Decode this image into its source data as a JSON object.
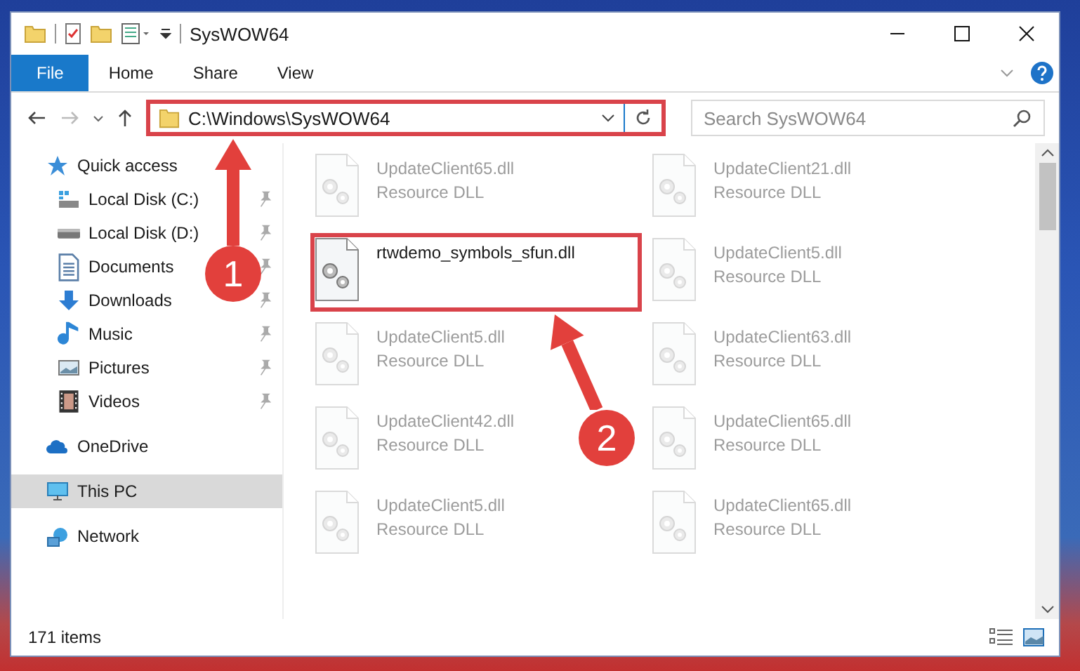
{
  "window": {
    "title": "SysWOW64"
  },
  "ribbon_tabs": [
    {
      "label": "File",
      "selected": true
    },
    {
      "label": "Home",
      "selected": false
    },
    {
      "label": "Share",
      "selected": false
    },
    {
      "label": "View",
      "selected": false
    }
  ],
  "address_bar": {
    "value": "C:\\Windows\\SysWOW64",
    "highlighted": true
  },
  "search": {
    "placeholder": "Search SysWOW64"
  },
  "sidebar": {
    "items": [
      {
        "label": "Quick access",
        "selected": false,
        "children": [
          {
            "label": "Local Disk (C:)",
            "pinned": true,
            "selected": false
          },
          {
            "label": "Local Disk (D:)",
            "pinned": true,
            "selected": false
          },
          {
            "label": "Documents",
            "pinned": true,
            "selected": false
          },
          {
            "label": "Downloads",
            "pinned": true,
            "selected": false
          },
          {
            "label": "Music",
            "pinned": true,
            "selected": false
          },
          {
            "label": "Pictures",
            "pinned": true,
            "selected": false
          },
          {
            "label": "Videos",
            "pinned": true,
            "selected": false
          }
        ]
      },
      {
        "label": "OneDrive",
        "selected": false
      },
      {
        "label": "This PC",
        "selected": true
      },
      {
        "label": "Network",
        "selected": false
      }
    ]
  },
  "files": [
    {
      "name": "UpdateClient65.dll",
      "type": "Resource DLL",
      "dimmed": true,
      "highlighted": false
    },
    {
      "name": "UpdateClient21.dll",
      "type": "Resource DLL",
      "dimmed": true,
      "highlighted": false
    },
    {
      "name": "rtwdemo_symbols_sfun.dll",
      "dimmed": false,
      "highlighted": true
    },
    {
      "name": "UpdateClient5.dll",
      "type": "Resource DLL",
      "dimmed": true,
      "highlighted": false
    },
    {
      "name": "UpdateClient5.dll",
      "type": "Resource DLL",
      "dimmed": true,
      "highlighted": false
    },
    {
      "name": "UpdateClient63.dll",
      "type": "Resource DLL",
      "dimmed": true,
      "highlighted": false
    },
    {
      "name": "UpdateClient42.dll",
      "type": "Resource DLL",
      "dimmed": true,
      "highlighted": false
    },
    {
      "name": "UpdateClient65.dll",
      "type": "Resource DLL",
      "dimmed": true,
      "highlighted": false
    },
    {
      "name": "UpdateClient5.dll",
      "type": "Resource DLL",
      "dimmed": true,
      "highlighted": false
    },
    {
      "name": "UpdateClient65.dll",
      "type": "Resource DLL",
      "dimmed": true,
      "highlighted": false
    }
  ],
  "annotations": [
    {
      "label": "1"
    },
    {
      "label": "2"
    }
  ],
  "status_bar": {
    "item_count": "171 items"
  }
}
